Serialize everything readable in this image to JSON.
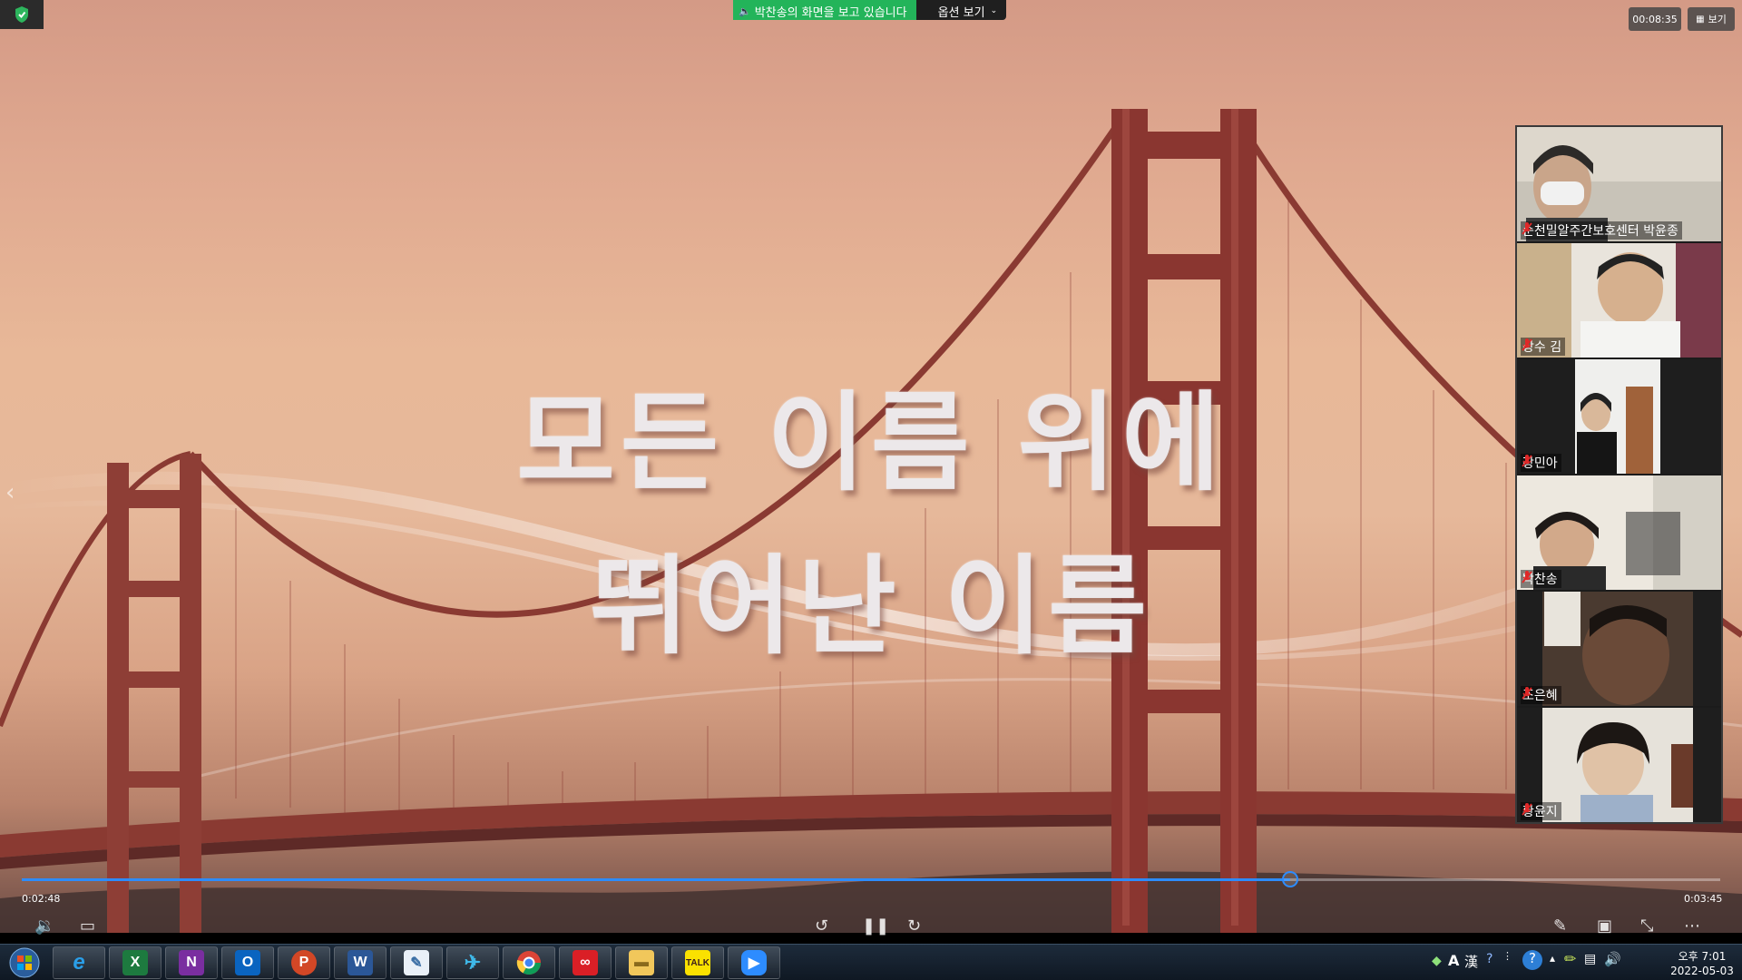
{
  "share_banner": {
    "status_text": "박찬송의 화면을 보고 있습니다",
    "options_label": "옵션 보기"
  },
  "header": {
    "timer": "00:08:35",
    "view_label": "보기"
  },
  "lyrics": {
    "line1": "모든 이름 위에",
    "line2": "뛰어난 이름"
  },
  "participants": [
    {
      "name": "순천밀알주간보호센터 박윤종",
      "muted": true
    },
    {
      "name": "상수 김",
      "muted": true
    },
    {
      "name": "장민아",
      "muted": true
    },
    {
      "name": "박찬송",
      "muted": true,
      "active_speaker": true
    },
    {
      "name": "조은혜",
      "muted": true
    },
    {
      "name": "황윤지",
      "muted": true
    }
  ],
  "player": {
    "current_time": "0:02:48",
    "total_time": "0:03:45",
    "progress": 0.747
  },
  "taskbar": {
    "apps": [
      "internet-explorer",
      "excel",
      "onenote",
      "outlook",
      "powerpoint",
      "word",
      "paint-tool",
      "messenger",
      "chrome",
      "adobe-cloud",
      "file-explorer",
      "kakaotalk",
      "zoom"
    ],
    "kakao_label": "TALK",
    "clock_time": "오후 7:01",
    "clock_date": "2022-05-03"
  },
  "colors": {
    "share_green": "#23b45a",
    "seek_blue": "#2d8cff",
    "active_tile": "#8bc34a"
  }
}
